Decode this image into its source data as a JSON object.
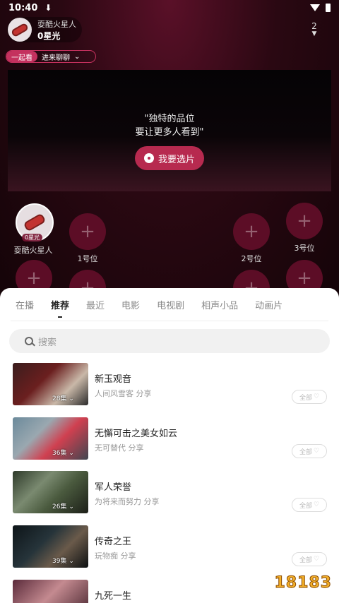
{
  "status": {
    "time": "10:40",
    "download_icon": "download-icon"
  },
  "host": {
    "name": "耍酷火星人",
    "stars": "0星光",
    "online": "2"
  },
  "together": {
    "tag": "一起看",
    "chat": "进来聊聊"
  },
  "video": {
    "slogan_line1": "\"独特的品位",
    "slogan_line2": "要让更多人看到\"",
    "pick_button": "我要选片"
  },
  "seats": {
    "host_name": "耍酷火星人",
    "host_stars": "0星光",
    "labels": [
      "1号位",
      "2号位",
      "3号位"
    ],
    "plus": "+"
  },
  "sheet": {
    "tabs": [
      "在播",
      "推荐",
      "最近",
      "电影",
      "电视剧",
      "相声小品",
      "动画片"
    ],
    "active_tab": "推荐",
    "search_placeholder": "搜索",
    "all_label": "全部",
    "items": [
      {
        "title": "新玉观音",
        "sub": "人间风雪客 分享",
        "ep": "28集"
      },
      {
        "title": "无懈可击之美女如云",
        "sub": "无可替代 分享",
        "ep": "36集"
      },
      {
        "title": "军人荣誉",
        "sub": "为将来而努力 分享",
        "ep": "26集"
      },
      {
        "title": "传奇之王",
        "sub": "玩物痴 分享",
        "ep": "39集"
      },
      {
        "title": "九死一生",
        "sub": "",
        "ep": ""
      }
    ]
  },
  "watermark": "18183"
}
